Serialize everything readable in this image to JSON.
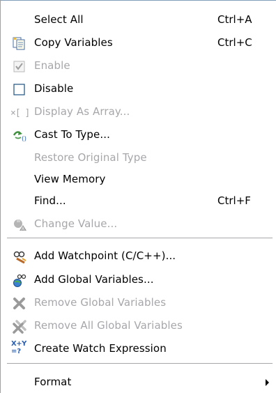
{
  "menu": {
    "items": [
      {
        "id": "select-all",
        "label": "Select All",
        "accel": "Ctrl+A",
        "enabled": true,
        "icon": "none"
      },
      {
        "id": "copy-variables",
        "label": "Copy Variables",
        "accel": "Ctrl+C",
        "enabled": true,
        "icon": "copy-document-icon"
      },
      {
        "id": "enable",
        "label": "Enable",
        "accel": "",
        "enabled": false,
        "icon": "checked-checkbox-icon"
      },
      {
        "id": "disable",
        "label": "Disable",
        "accel": "",
        "enabled": true,
        "icon": "empty-checkbox-icon"
      },
      {
        "id": "display-as-array",
        "label": "Display As Array...",
        "accel": "",
        "enabled": false,
        "icon": "array-brackets-icon"
      },
      {
        "id": "cast-to-type",
        "label": "Cast To Type...",
        "accel": "",
        "enabled": true,
        "icon": "cast-type-icon"
      },
      {
        "id": "restore-original-type",
        "label": "Restore Original Type",
        "accel": "",
        "enabled": false,
        "icon": "none"
      },
      {
        "id": "view-memory",
        "label": "View Memory",
        "accel": "",
        "enabled": true,
        "icon": "none"
      },
      {
        "id": "find",
        "label": "Find...",
        "accel": "Ctrl+F",
        "enabled": true,
        "icon": "none"
      },
      {
        "id": "change-value",
        "label": "Change Value...",
        "accel": "",
        "enabled": false,
        "icon": "change-value-icon"
      },
      {
        "id": "add-watchpoint",
        "label": "Add Watchpoint (C/C++)...",
        "accel": "",
        "enabled": true,
        "icon": "watchpoint-glasses-icon"
      },
      {
        "id": "add-global-variables",
        "label": "Add Global Variables...",
        "accel": "",
        "enabled": true,
        "icon": "globe-variables-icon"
      },
      {
        "id": "remove-global-variables",
        "label": "Remove Global Variables",
        "accel": "",
        "enabled": false,
        "icon": "remove-x-icon"
      },
      {
        "id": "remove-all-global-variables",
        "label": "Remove All Global Variables",
        "accel": "",
        "enabled": false,
        "icon": "remove-all-x-icon"
      },
      {
        "id": "create-watch-expression",
        "label": "Create Watch Expression",
        "accel": "",
        "enabled": true,
        "icon": "watch-expression-icon"
      },
      {
        "id": "format",
        "label": "Format",
        "accel": "",
        "enabled": true,
        "icon": "none",
        "submenu": true
      }
    ],
    "icon_text": {
      "array": "×[ ]",
      "watch_expression_top": "X+Y",
      "watch_expression_bottom": "=?"
    }
  }
}
